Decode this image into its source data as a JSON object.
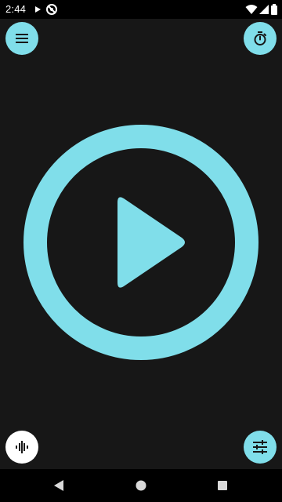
{
  "status_bar": {
    "time": "2:44",
    "icons": [
      "play-store-icon",
      "no-disturb-icon",
      "wifi-icon",
      "signal-icon",
      "battery-icon"
    ]
  },
  "controls": {
    "menu_icon": "menu-icon",
    "timer_icon": "timer-icon",
    "play_icon": "play-icon",
    "sound_icon": "waveform-icon",
    "equalizer_icon": "equalizer-icon"
  },
  "navigation": {
    "icons": [
      "back-icon",
      "home-icon",
      "recents-icon"
    ]
  },
  "colors": {
    "accent": "#80deea",
    "background": "#171717",
    "bars": "#000000",
    "white_button": "#ffffff"
  }
}
